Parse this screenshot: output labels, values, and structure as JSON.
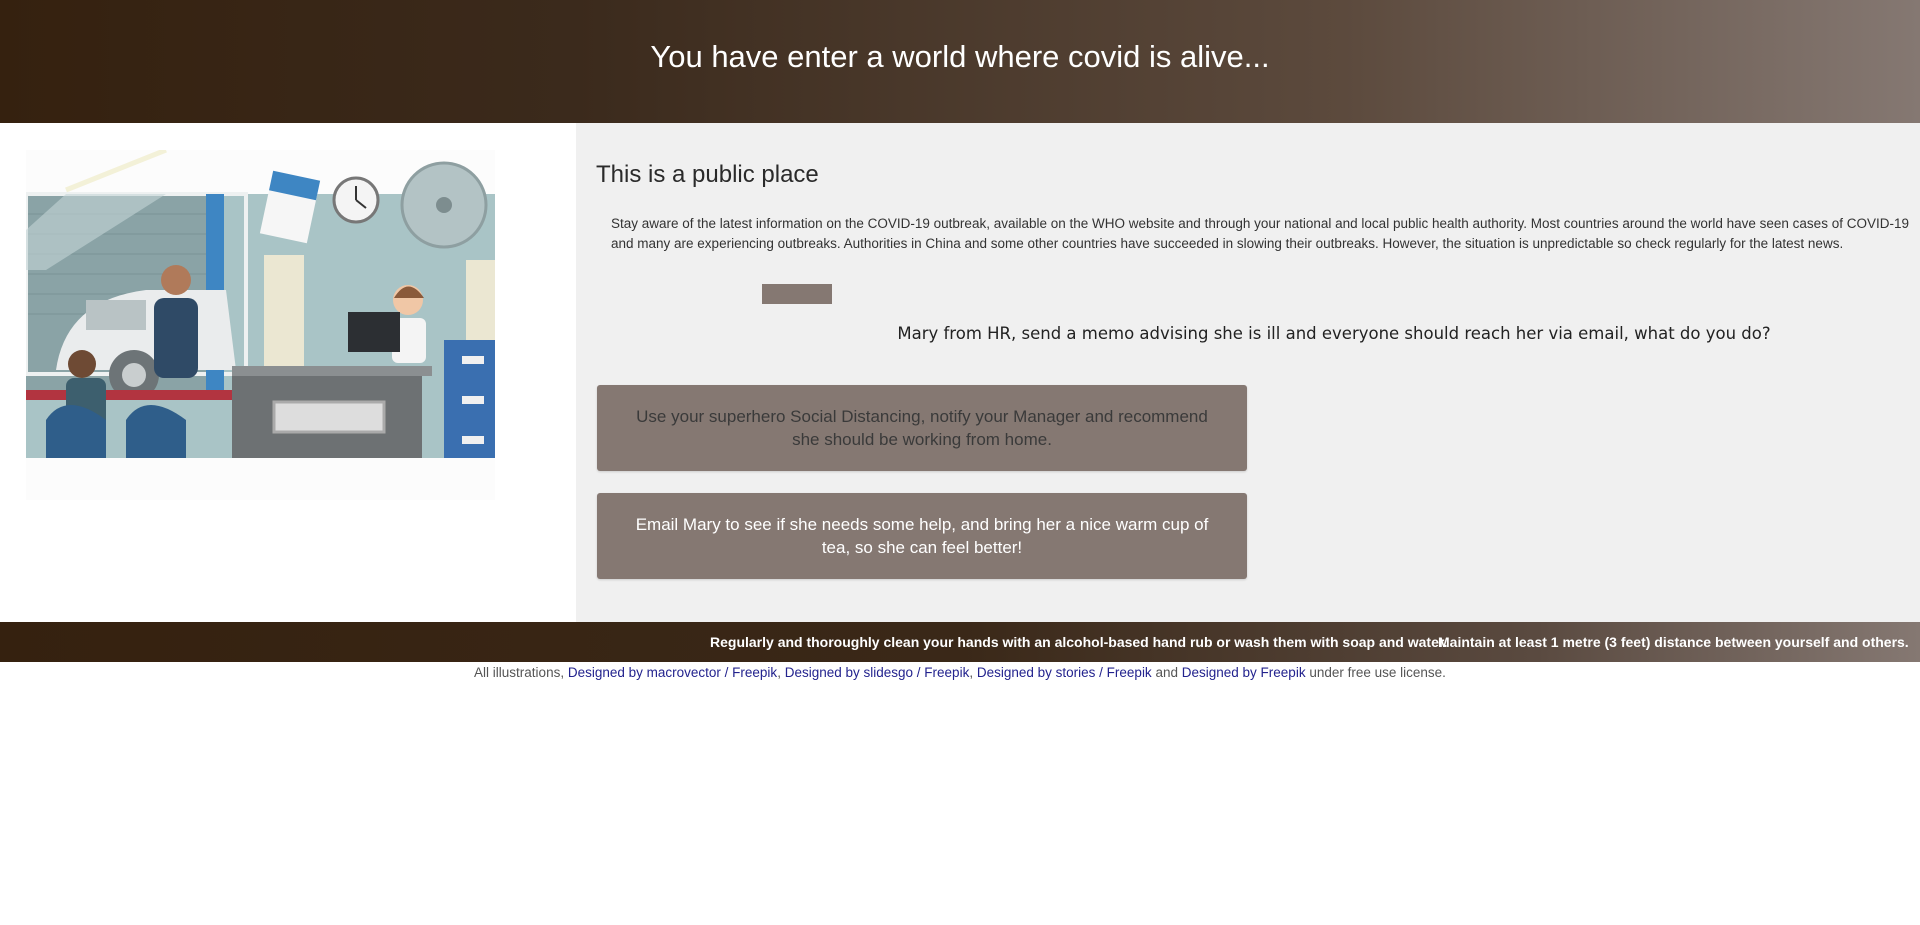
{
  "header": {
    "title": "You have enter a world where covid is alive..."
  },
  "scene": {
    "title": "This is a public place",
    "description": "Stay aware of the latest information on the COVID-19 outbreak, available on the WHO website and through your national and local public health authority. Most countries around the world have seen cases of COVID-19 and many are experiencing outbreaks. Authorities in China and some other countries have succeeded in slowing their outbreaks. However, the situation is unpredictable so check regularly for the latest news.",
    "question": "Mary from HR, send a memo advising she is ill and everyone should reach her via email, what do you do?",
    "choices": [
      {
        "label": "Use your superhero Social Distancing, notify your Manager and recommend she should be working from home."
      },
      {
        "label": "Email Mary to see if she needs some help, and bring her a nice warm cup of tea, so she can feel better!"
      }
    ]
  },
  "ticker": {
    "tips": [
      "Regularly and thoroughly clean your hands with an alcohol-based hand rub or wash them with soap and water.",
      "Maintain at least 1 metre (3 feet) distance between yourself and others."
    ]
  },
  "credits": {
    "prefix": "All illustrations,",
    "links": [
      "Designed by macrovector / Freepik",
      "Designed by slidesgo / Freepik",
      "Designed by stories / Freepik",
      "Designed by Freepik"
    ],
    "sep": ",",
    "and": "and",
    "suffix": "under free use license."
  },
  "colors": {
    "header_dark": "#35210f",
    "header_light": "#857872",
    "button_bg": "#857872",
    "pane_bg": "#f0f0f0",
    "link": "#23238e"
  }
}
